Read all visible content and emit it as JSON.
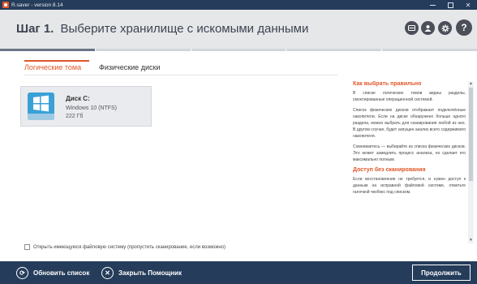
{
  "window": {
    "title": "R.saver - version 8.14"
  },
  "header": {
    "step_label": "Шаг 1.",
    "step_title": "Выберите хранилище с искомыми данными",
    "help_symbol": "?",
    "progress": {
      "segments": 5,
      "active": 1
    }
  },
  "tabs": [
    {
      "label": "Логические тома",
      "active": true
    },
    {
      "label": "Физические диски",
      "active": false
    }
  ],
  "disks": [
    {
      "name": "Диск С:",
      "os": "Windows 10 (NTFS)",
      "size": "222 Гб"
    }
  ],
  "help": {
    "heading1": "Как выбрать правильно",
    "p1": "В списке логических томов видны разделы, смонтированные операционной системой.",
    "p2": "Список физических дисков отображает подключённые накопители. Если на диске обнаружено больше одного раздела, можно выбрать для сканирования любой из них. В другом случае, будет запущен анализ всего содержимого накопителя.",
    "p3": "Сомневаетесь — выбирайте из списка физических дисков. Это может замедлить процесс анализа, но сделает его максимально полным.",
    "heading2": "Доступ без сканирования",
    "p4": "Если восстановление не требуется, и нужен доступ к данным на исправной файловой системе, отметьте галочкой чекбокс под списком."
  },
  "checkbox": {
    "label": "Открыть имеющуюся файловую систему (пропустить сканирование, если возможно)",
    "checked": false
  },
  "footer": {
    "refresh_label": "Обновить список",
    "close_label": "Закрыть Помощник",
    "next_label": "Продолжить"
  },
  "colors": {
    "accent": "#e0572b",
    "dark": "#253c5a",
    "header_bg": "#e6e7e9"
  }
}
